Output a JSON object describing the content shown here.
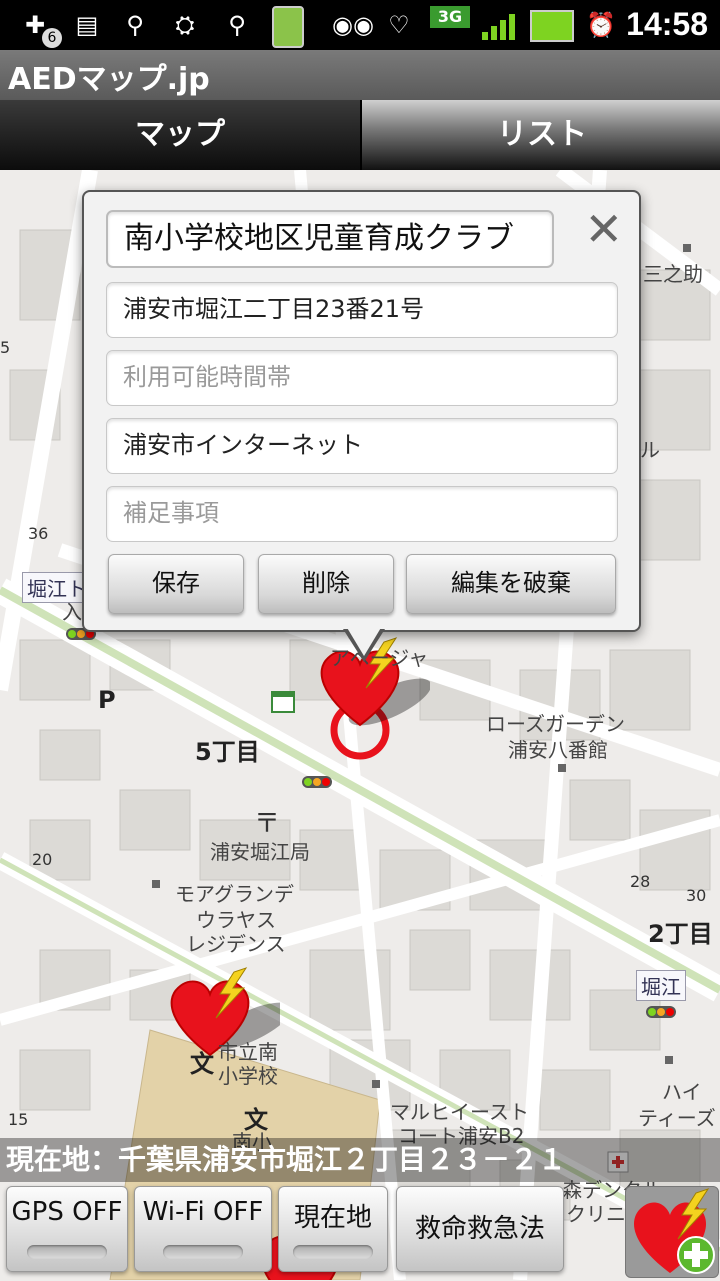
{
  "statusbar": {
    "time": "14:58",
    "network": "3G",
    "notification_count": "6",
    "icons": [
      "plus-notification-icon",
      "clipboard-icon",
      "usb-icon",
      "android-debug-icon",
      "usb-icon",
      "battery-device-icon",
      "voicemail-icon",
      "heart-icon",
      "signal-3g-icon",
      "battery-charging-icon",
      "alarm-icon"
    ]
  },
  "app": {
    "title": "AEDマップ.jp"
  },
  "tabs": [
    {
      "label": "マップ",
      "active": true
    },
    {
      "label": "リスト",
      "active": false
    }
  ],
  "popup": {
    "name_value": "南小学校地区児童育成クラブ",
    "address_value": "浦安市堀江二丁目23番21号",
    "hours_placeholder": "利用可能時間帯",
    "source_value": "浦安市インターネット",
    "notes_placeholder": "補足事項",
    "close_label": "✕",
    "buttons": {
      "save": "保存",
      "delete": "削除",
      "discard": "編集を破棄"
    }
  },
  "map_labels": {
    "mitsunosuke": "三之助",
    "horie_station": "堀江ト",
    "iri": "入",
    "n36": "36",
    "n5": "5",
    "ru": "ル",
    "ssage": "アベージャ",
    "p": "P",
    "five_chome": "5丁目",
    "rose1": "ローズガーデン",
    "rose2": "浦安八番館",
    "post1": "浦安堀江局",
    "moa1": "モアグランデ",
    "moa2": "ウラヤス",
    "moa3": "レジデンス",
    "n20": "20",
    "n28": "28",
    "n30": "30",
    "two_chome": "2丁目",
    "horie": "堀江",
    "school1": "市立南",
    "school2": "小学校",
    "bun": "文",
    "bun2": "文",
    "minami": "南小",
    "maruhi1": "マルヒイースト",
    "maruhi2": "コート浦安B2",
    "hai1": "ハイ",
    "hai2": "ティーズ",
    "n15": "15",
    "mori1": "森デンタル",
    "mori2": "クリニック"
  },
  "current_location": {
    "text": "現在地：千葉県浦安市堀江２丁目２３－２１"
  },
  "bottom_buttons": {
    "gps": "GPS OFF",
    "wifi": "Wi-Fi OFF",
    "here": "現在地",
    "emergency": "救命救急法"
  },
  "colors": {
    "map_bg": "#eeecea",
    "road": "#ffffff",
    "building": "#dcdad6",
    "green_road": "#cfe3b8",
    "aed_red": "#e8121c",
    "bolt_yellow": "#f4d21f"
  }
}
